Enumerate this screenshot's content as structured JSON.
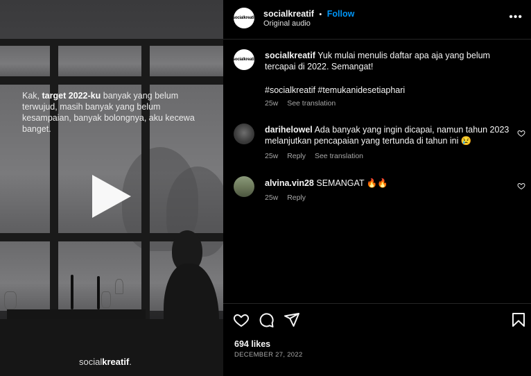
{
  "media": {
    "overlay_prefix": "Kak, ",
    "overlay_bold": "target 2022-ku",
    "overlay_suffix": " banyak yang belum terwujud, masih banyak yang belum kesampaian, banyak bolongnya, aku kecewa banget.",
    "brand_regular": "social",
    "brand_bold": "kreatif",
    "brand_dot": "."
  },
  "header": {
    "avatar_text": "socialkreatif",
    "username": "socialkreatif",
    "separator": "•",
    "follow_label": "Follow",
    "audio": "Original audio",
    "more_label": "•••"
  },
  "caption": {
    "avatar_text": "socialkreatif",
    "username": "socialkreatif",
    "text": "Yuk mulai menulis daftar apa aja yang belum tercapai di 2022. Semangat!",
    "hashtags": "#socialkreatif #temukanidesetiaphari",
    "time": "25w",
    "see_translation": "See translation"
  },
  "comments": [
    {
      "username": "darihelowel",
      "text": "Ada banyak yang ingin dicapai, namun tahun 2023 melanjutkan pencapaian yang tertunda di tahun ini 😢",
      "time": "25w",
      "reply": "Reply",
      "see_translation": "See translation"
    },
    {
      "username": "alvina.vin28",
      "text": "SEMANGAT 🔥🔥",
      "time": "25w",
      "reply": "Reply"
    }
  ],
  "actions": {
    "likes": "694 likes",
    "date": "DECEMBER 27, 2022"
  },
  "colors": {
    "accent": "#0095f6",
    "background": "#000000",
    "text": "#f5f5f5",
    "muted": "#a8a8a8",
    "divider": "#262626"
  },
  "icons": [
    "heart-icon",
    "comment-icon",
    "share-icon",
    "bookmark-icon",
    "more-icon",
    "play-icon"
  ]
}
